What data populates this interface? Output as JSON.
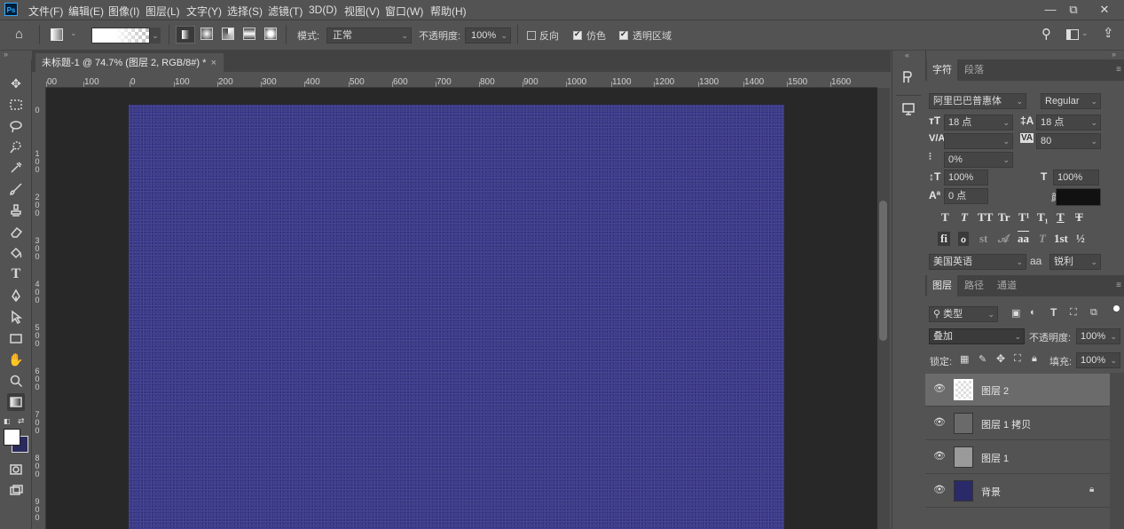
{
  "app": {
    "logo": "Ps",
    "menus": [
      "文件(F)",
      "编辑(E)",
      "图像(I)",
      "图层(L)",
      "文字(Y)",
      "选择(S)",
      "滤镜(T)",
      "3D(D)",
      "视图(V)",
      "窗口(W)",
      "帮助(H)"
    ],
    "window_buttons": [
      "—",
      "⧉",
      "✕"
    ]
  },
  "options_bar": {
    "mode_label": "模式:",
    "mode_value": "正常",
    "opacity_label": "不透明度:",
    "opacity_value": "100%",
    "reverse_label": "反向",
    "reverse_checked": false,
    "dither_label": "仿色",
    "dither_checked": true,
    "transparency_label": "透明区域",
    "transparency_checked": true
  },
  "document": {
    "tab_title": "未标题-1 @ 74.7% (图层 2, RGB/8#) *",
    "tab_close": "×",
    "canvas_color": "#3b3a8c"
  },
  "rulers": {
    "horizontal": [
      "00",
      "100",
      "0",
      "100",
      "200",
      "300",
      "400",
      "500",
      "600",
      "700",
      "800",
      "900",
      "1000",
      "1100",
      "1200",
      "1300",
      "1400",
      "1500",
      "1600"
    ],
    "vertical": [
      "0",
      "100",
      "200",
      "300",
      "400",
      "500",
      "600",
      "700",
      "800",
      "900"
    ]
  },
  "character_panel": {
    "tabs": [
      "字符",
      "段落"
    ],
    "font_family": "阿里巴巴普惠体",
    "font_style": "Regular",
    "font_size": "18 点",
    "leading": "18 点",
    "kerning": "",
    "tracking": "80",
    "tsume": "0%",
    "vertical_scale": "100%",
    "horizontal_scale": "100%",
    "baseline_shift": "0 点",
    "color_label": "颜色:",
    "color_value": "#111111",
    "language": "美国英语",
    "antialias_label": "aa",
    "antialias": "锐利",
    "style_glyphs": [
      "T",
      "T",
      "TT",
      "Tr",
      "T¹",
      "T₁",
      "T",
      "T"
    ],
    "opentype_glyphs": [
      "fi",
      "ℴ",
      "st",
      "𝒜",
      "aa",
      "T",
      "1st",
      "½"
    ]
  },
  "layers_panel": {
    "tabs": [
      "图层",
      "路径",
      "通道"
    ],
    "filter_label": "类型",
    "blend_mode": "叠加",
    "opacity_label": "不透明度:",
    "opacity_value": "100%",
    "lock_label": "锁定:",
    "fill_label": "填充:",
    "fill_value": "100%",
    "layers": [
      {
        "name": "图层 2",
        "selected": true,
        "thumb": "white"
      },
      {
        "name": "图层 1 拷贝",
        "selected": false,
        "thumb": "gray"
      },
      {
        "name": "图层 1",
        "selected": false,
        "thumb": "lightgray"
      },
      {
        "name": "背景",
        "selected": false,
        "thumb": "navy",
        "locked": true
      }
    ]
  }
}
